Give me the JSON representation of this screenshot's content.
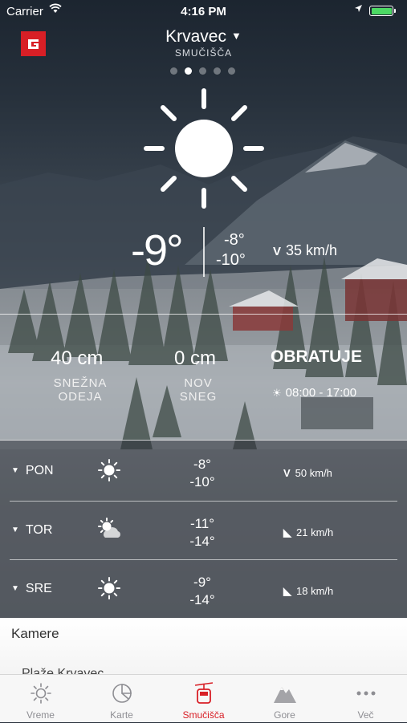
{
  "status_bar": {
    "carrier": "Carrier",
    "time": "4:16 PM"
  },
  "header": {
    "location": "Krvavec",
    "subtitle": "SMUČIŠČA",
    "pages": 5,
    "active_page": 2
  },
  "current": {
    "icon": "sun-icon",
    "temperature": "-9°",
    "temp_max": "-8°",
    "temp_min": "-10°",
    "wind": "35 km/h",
    "wind_icon": "wind-direction-icon"
  },
  "stats": {
    "snow_depth_value": "40 cm",
    "snow_depth_label_1": "SNEŽNA",
    "snow_depth_label_2": "ODEJA",
    "new_snow_value": "0 cm",
    "new_snow_label_1": "NOV",
    "new_snow_label_2": "SNEG",
    "status": "OBRATUJE",
    "hours": "08:00 - 17:00"
  },
  "forecast": [
    {
      "day": "PON",
      "icon": "sun-icon",
      "tmax": "-8°",
      "tmin": "-10°",
      "wind": "50 km/h"
    },
    {
      "day": "TOR",
      "icon": "partly-cloudy-icon",
      "tmax": "-11°",
      "tmin": "-14°",
      "wind": "21 km/h"
    },
    {
      "day": "SRE",
      "icon": "sun-icon",
      "tmax": "-9°",
      "tmin": "-14°",
      "wind": "18 km/h"
    }
  ],
  "panel": {
    "heading": "Kamere",
    "peek": "Plaže Krvavec"
  },
  "tabs": [
    {
      "label": "Vreme",
      "icon": "sun-outline-icon"
    },
    {
      "label": "Karte",
      "icon": "chart-icon"
    },
    {
      "label": "Smučišča",
      "icon": "cable-car-icon",
      "active": true
    },
    {
      "label": "Gore",
      "icon": "mountain-icon"
    },
    {
      "label": "Več",
      "icon": "more-icon"
    }
  ],
  "colors": {
    "accent": "#d81f26",
    "battery": "#4cd964"
  }
}
